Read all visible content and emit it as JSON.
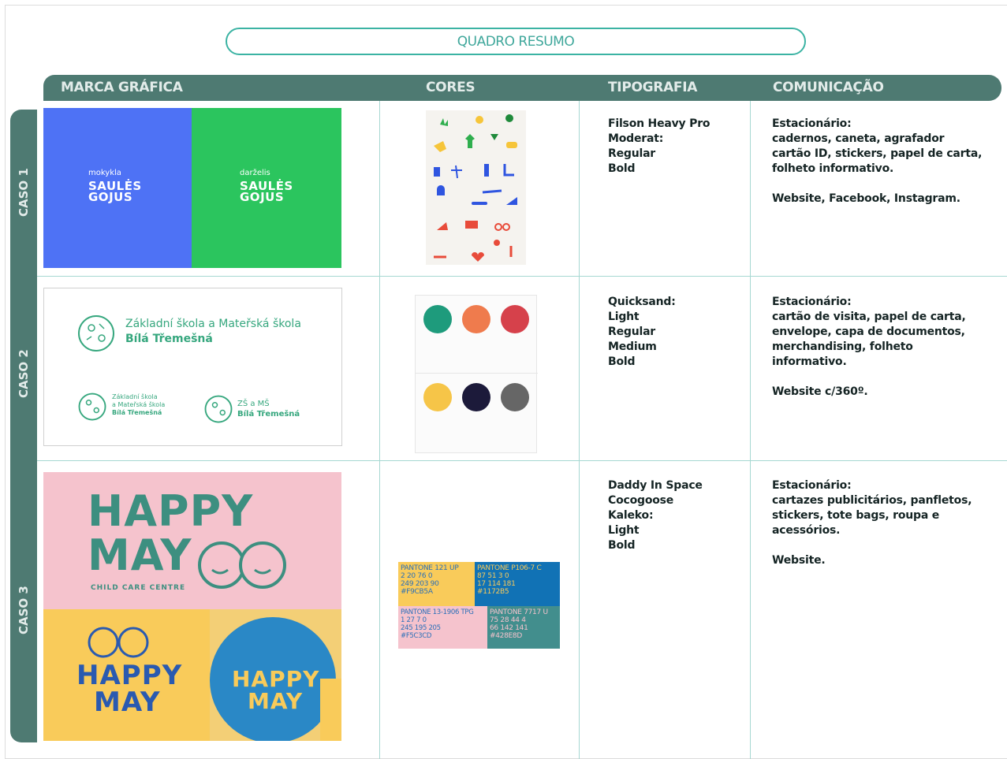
{
  "title": "QUADRO RESUMO",
  "headers": {
    "marca": "MARCA GRÁFICA",
    "cores": "CORES",
    "tipografia": "TIPOGRAFIA",
    "comunicacao": "COMUNICAÇÃO"
  },
  "cases": {
    "c1": {
      "label": "CASO 1",
      "brand": {
        "left_small": "mokykla",
        "right_small": "darželis",
        "name_line1": "SAULĖS",
        "name_line2": "GOJUS",
        "colors": {
          "left": "#4e72f5",
          "right": "#2bc55e"
        }
      },
      "tipografia": [
        "Filson Heavy Pro",
        "Moderat:",
        "Regular",
        "Bold"
      ],
      "comunicacao": [
        "Estacionário:",
        "cadernos, caneta, agrafador",
        "cartão ID, stickers, papel de carta,",
        "folheto informativo.",
        "",
        "Website, Facebook, Instagram."
      ]
    },
    "c2": {
      "label": "CASO 2",
      "brand": {
        "line1": "Základní škola a Mateřská škola",
        "line2": "Bílá Třemešná",
        "small1_a": "Základní škola",
        "small1_b": "a Mateřská škola",
        "small1_c": "Bílá Třemešná",
        "small2_a": "ZŠ a MŠ",
        "small2_b": "Bílá Třemešná"
      },
      "palette": [
        "#1e9b7c",
        "#ef7b4d",
        "#d6414b",
        "#f6c548",
        "#1c1a3a",
        "#666666"
      ],
      "tipografia": [
        "Quicksand:",
        "Light",
        "Regular",
        "Medium",
        "Bold"
      ],
      "comunicacao": [
        "Estacionário:",
        "cartão de visita, papel de carta,",
        "envelope, capa de documentos,",
        "merchandising, folheto",
        "informativo.",
        "",
        "Website c/360º."
      ]
    },
    "c3": {
      "label": "CASO 3",
      "brand": {
        "happy": "HAPPY",
        "may": "MAY",
        "sub": "CHILD CARE CENTRE"
      },
      "pantone": [
        {
          "name": "PANTONE 121 UP",
          "l1": "2 20 76 0",
          "l2": "249 203 90",
          "l3": "#F9CB5A",
          "bg": "#f9cb5a",
          "fg": "#2a6fb8"
        },
        {
          "name": "PANTONE P106-7 C",
          "l1": "87 51 3 0",
          "l2": "17 114 181",
          "l3": "#1172B5",
          "bg": "#1172b5",
          "fg": "#f9cb5a"
        },
        {
          "name": "PANTONE 13-1906 TPG",
          "l1": "1 27 7 0",
          "l2": "245 195 205",
          "l3": "#F5C3CD",
          "bg": "#f5c3cd",
          "fg": "#2a6fb8"
        },
        {
          "name": "PANTONE 7717 U",
          "l1": "75 28 44 4",
          "l2": "66 142 141",
          "l3": "#428E8D",
          "bg": "#428e8d",
          "fg": "#f5c3cd"
        }
      ],
      "tipografia": [
        "Daddy In Space",
        "Cocogoose",
        "Kaleko:",
        "Light",
        "Bold"
      ],
      "comunicacao": [
        "Estacionário:",
        "cartazes publicitários, panfletos,",
        "stickers, tote bags, roupa e",
        "acessórios.",
        "",
        "Website."
      ]
    }
  },
  "accent": "#4e7a72"
}
